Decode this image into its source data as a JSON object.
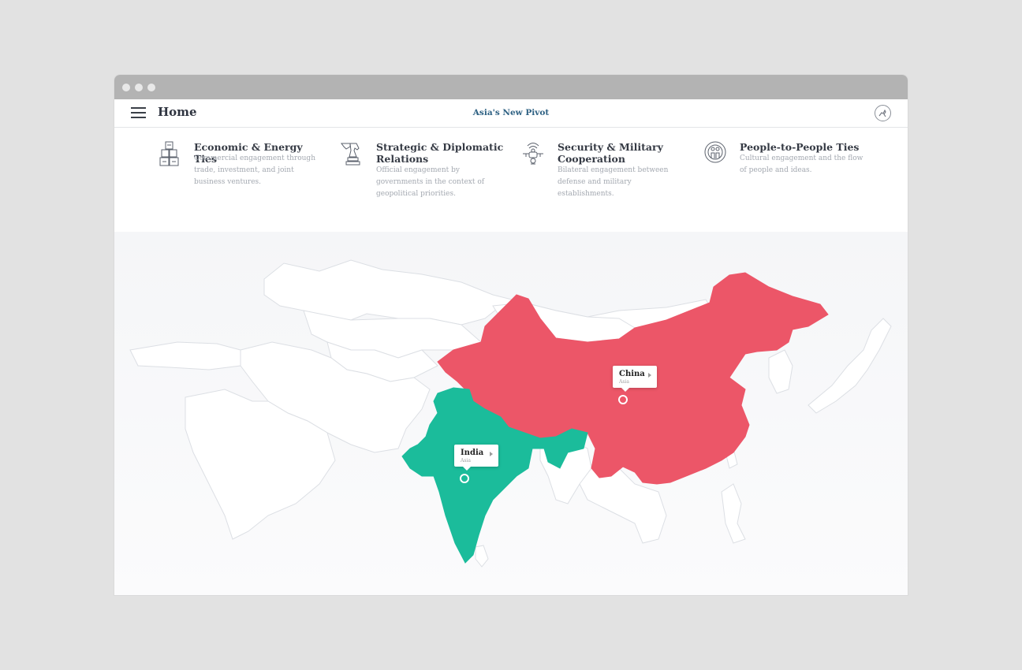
{
  "window": {
    "dots": 3
  },
  "navbar": {
    "home_label": "Home",
    "title": "Asia's New Pivot",
    "menu_icon": "hamburger-menu-icon",
    "brand_icon": "horse-logo-icon"
  },
  "categories": [
    {
      "title": "Economic & Energy Ties",
      "description": "Commercial engagement through trade, investment, and joint business ventures.",
      "icon": "barrels-icon"
    },
    {
      "title": "Strategic & Diplomatic Relations",
      "description": "Official engagement by governments in the context of geopolitical priorities.",
      "icon": "chess-knight-icon"
    },
    {
      "title": "Security & Military Cooperation",
      "description": "Bilateral engagement between defense and military establishments.",
      "icon": "drone-icon"
    },
    {
      "title": "People-to-People Ties",
      "description": "Cultural engagement and the flow of people and ideas.",
      "icon": "people-icon"
    }
  ],
  "map": {
    "countries": [
      {
        "name": "China",
        "region": "Asia",
        "color": "#ec5668"
      },
      {
        "name": "India",
        "region": "Asia",
        "color": "#1bbc9b"
      }
    ],
    "base_fill": "#ffffff",
    "border_color": "#dcdfe4"
  }
}
